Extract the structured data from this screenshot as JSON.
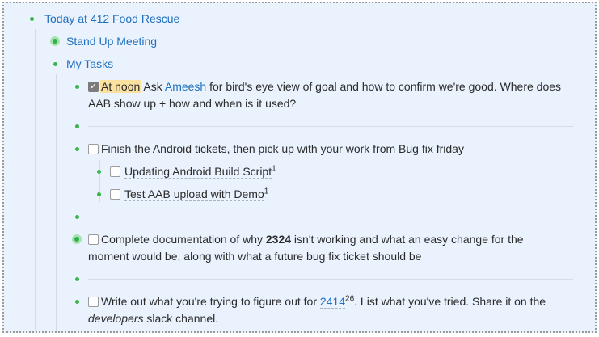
{
  "outline": {
    "root": {
      "label": "Today at 412 Food Rescue"
    },
    "standup": {
      "label": "Stand Up Meeting"
    },
    "my_tasks": {
      "label": "My Tasks"
    },
    "task1": {
      "highlight": "At noon",
      "pre": "Ask ",
      "mention": "Ameesh",
      "line1_rest": " for bird's eye view of goal and how to confirm we're good. Where does",
      "line2": "AAB show up + how and when is it used?"
    },
    "task2": {
      "label": "Finish the Android tickets, then pick up with your work from Bug fix friday"
    },
    "sub1": {
      "label": "Updating Android Build Script",
      "count": "1"
    },
    "sub2": {
      "label": "Test AAB upload with Demo",
      "count": "1"
    },
    "task3": {
      "pre": "Complete documentation of why ",
      "bold": "2324",
      "line1_rest": " isn't working and what an easy change for the",
      "line2": "moment would be, along with what a future bug fix ticket should be"
    },
    "task4": {
      "pre": "Write out what you're trying to figure out for ",
      "ref": "2414",
      "ref_count": "26",
      "post": ". List what you've tried. Share it on the",
      "italic": "developers",
      "line2_rest": " slack channel."
    }
  },
  "colors": {
    "bullet": "#39b54a",
    "link": "#1f6fbf",
    "highlight": "#fbe1a0",
    "background": "#e9f2fd"
  }
}
